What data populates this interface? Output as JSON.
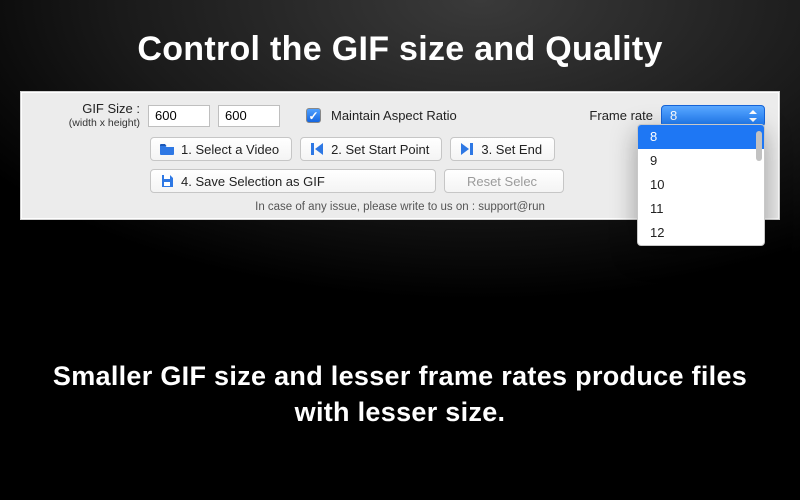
{
  "headline": "Control the GIF size and Quality",
  "panel": {
    "size_label": "GIF Size :",
    "size_sublabel": "(width x height)",
    "width_value": "600",
    "height_value": "600",
    "aspect_label": "Maintain Aspect Ratio",
    "aspect_checked": true,
    "frame_rate_label": "Frame rate",
    "frame_rate_value": "8",
    "frame_rate_options": [
      "8",
      "9",
      "10",
      "11",
      "12"
    ],
    "buttons": {
      "select_video": "1. Select a Video",
      "set_start": "2. Set Start Point",
      "set_end": "3. Set End",
      "save_gif": "4. Save Selection as GIF",
      "reset": "Reset Selec"
    },
    "support_text": "In case of any issue, please write to us on : support@run"
  },
  "footer": "Smaller GIF size and lesser frame rates produce files with lesser size."
}
